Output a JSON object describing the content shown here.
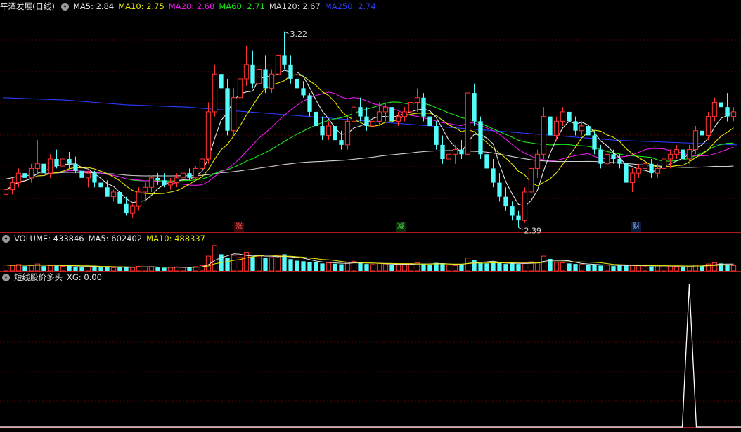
{
  "main_header": {
    "title": "平潭发展(日线)",
    "indicators": [
      {
        "text": "MA5: 2.84",
        "color": "#e6e6e6"
      },
      {
        "text": "MA10: 2.75",
        "color": "#e7e700"
      },
      {
        "text": "MA20: 2.68",
        "color": "#e619e6"
      },
      {
        "text": "MA60: 2.71",
        "color": "#19e619"
      },
      {
        "text": "MA120: 2.67",
        "color": "#d0d0d0"
      },
      {
        "text": "MA250: 2.74",
        "color": "#2a3cff"
      }
    ]
  },
  "price_high_label": "3.22",
  "price_low_label": "2.39",
  "markers": [
    {
      "label": "涨",
      "bg": "#3a0808",
      "color": "#ff5a5a"
    },
    {
      "label": "减",
      "bg": "#0a2a0a",
      "color": "#4fdc4f"
    },
    {
      "label": "财",
      "bg": "#0a1a3a",
      "color": "#9ab8ff"
    }
  ],
  "volume_header": {
    "name": "VOLUME: 433846",
    "ma5": "MA5: 602402",
    "ma10": "MA10: 488337"
  },
  "signal_header": {
    "name": "短线股价多头",
    "value": "XG: 0.00"
  },
  "colors": {
    "up": "#ff3232",
    "down": "#54fcfc",
    "grid": "#5a0000",
    "divider": "#b01818",
    "ma5": "#e6e6e6",
    "ma10": "#e7e700",
    "ma20": "#e619e6",
    "ma60": "#19e619",
    "ma120": "#d0d0d0",
    "ma250": "#2a3cff",
    "signal": "#ffffff"
  },
  "chart_data": {
    "type": "candlestick",
    "candles": [
      [
        2.53,
        2.57,
        2.51,
        2.55
      ],
      [
        2.55,
        2.6,
        2.53,
        2.58
      ],
      [
        2.58,
        2.64,
        2.56,
        2.62
      ],
      [
        2.62,
        2.66,
        2.6,
        2.6
      ],
      [
        2.6,
        2.66,
        2.58,
        2.64
      ],
      [
        2.64,
        2.76,
        2.62,
        2.66
      ],
      [
        2.66,
        2.68,
        2.6,
        2.62
      ],
      [
        2.62,
        2.7,
        2.6,
        2.68
      ],
      [
        2.68,
        2.72,
        2.64,
        2.65
      ],
      [
        2.65,
        2.7,
        2.63,
        2.68
      ],
      [
        2.68,
        2.71,
        2.64,
        2.66
      ],
      [
        2.66,
        2.69,
        2.62,
        2.63
      ],
      [
        2.63,
        2.65,
        2.58,
        2.6
      ],
      [
        2.6,
        2.63,
        2.56,
        2.62
      ],
      [
        2.62,
        2.63,
        2.56,
        2.58
      ],
      [
        2.58,
        2.6,
        2.54,
        2.56
      ],
      [
        2.56,
        2.59,
        2.52,
        2.52
      ],
      [
        2.52,
        2.55,
        2.5,
        2.54
      ],
      [
        2.54,
        2.56,
        2.48,
        2.49
      ],
      [
        2.49,
        2.52,
        2.44,
        2.45
      ],
      [
        2.45,
        2.49,
        2.43,
        2.48
      ],
      [
        2.48,
        2.56,
        2.46,
        2.54
      ],
      [
        2.54,
        2.58,
        2.5,
        2.56
      ],
      [
        2.56,
        2.61,
        2.54,
        2.6
      ],
      [
        2.6,
        2.62,
        2.57,
        2.59
      ],
      [
        2.59,
        2.62,
        2.56,
        2.57
      ],
      [
        2.57,
        2.6,
        2.55,
        2.58
      ],
      [
        2.58,
        2.62,
        2.56,
        2.6
      ],
      [
        2.6,
        2.64,
        2.58,
        2.62
      ],
      [
        2.62,
        2.64,
        2.59,
        2.6
      ],
      [
        2.6,
        2.65,
        2.59,
        2.64
      ],
      [
        2.64,
        2.72,
        2.62,
        2.68
      ],
      [
        2.68,
        2.92,
        2.66,
        2.88
      ],
      [
        2.88,
        3.08,
        2.86,
        3.04
      ],
      [
        3.04,
        3.12,
        2.96,
        2.98
      ],
      [
        2.98,
        3.02,
        2.78,
        2.8
      ],
      [
        2.8,
        2.98,
        2.78,
        2.94
      ],
      [
        2.94,
        3.04,
        2.92,
        3.02
      ],
      [
        3.02,
        3.16,
        2.99,
        3.08
      ],
      [
        3.08,
        3.14,
        2.98,
        3.0
      ],
      [
        3.0,
        3.1,
        2.98,
        3.06
      ],
      [
        3.06,
        3.12,
        2.96,
        2.98
      ],
      [
        2.98,
        3.06,
        2.96,
        3.04
      ],
      [
        3.04,
        3.14,
        3.02,
        3.12
      ],
      [
        3.12,
        3.22,
        3.06,
        3.08
      ],
      [
        3.08,
        3.12,
        3.0,
        3.02
      ],
      [
        3.02,
        3.04,
        2.96,
        2.98
      ],
      [
        2.98,
        3.01,
        2.94,
        2.95
      ],
      [
        2.95,
        2.96,
        2.86,
        2.88
      ],
      [
        2.88,
        2.92,
        2.8,
        2.82
      ],
      [
        2.82,
        2.86,
        2.76,
        2.78
      ],
      [
        2.78,
        2.84,
        2.76,
        2.82
      ],
      [
        2.82,
        2.86,
        2.74,
        2.76
      ],
      [
        2.76,
        2.8,
        2.72,
        2.74
      ],
      [
        2.74,
        2.86,
        2.72,
        2.84
      ],
      [
        2.84,
        2.96,
        2.82,
        2.9
      ],
      [
        2.9,
        2.94,
        2.84,
        2.86
      ],
      [
        2.86,
        2.9,
        2.8,
        2.82
      ],
      [
        2.82,
        2.86,
        2.8,
        2.84
      ],
      [
        2.84,
        2.92,
        2.82,
        2.88
      ],
      [
        2.88,
        2.92,
        2.84,
        2.9
      ],
      [
        2.9,
        2.92,
        2.82,
        2.84
      ],
      [
        2.84,
        2.88,
        2.82,
        2.86
      ],
      [
        2.86,
        2.9,
        2.84,
        2.88
      ],
      [
        2.88,
        2.94,
        2.86,
        2.92
      ],
      [
        2.92,
        2.98,
        2.88,
        2.94
      ],
      [
        2.94,
        2.96,
        2.84,
        2.86
      ],
      [
        2.86,
        2.88,
        2.8,
        2.82
      ],
      [
        2.82,
        2.84,
        2.72,
        2.74
      ],
      [
        2.74,
        2.78,
        2.66,
        2.68
      ],
      [
        2.68,
        2.72,
        2.66,
        2.7
      ],
      [
        2.7,
        2.74,
        2.66,
        2.72
      ],
      [
        2.72,
        2.76,
        2.68,
        2.7
      ],
      [
        2.7,
        2.98,
        2.68,
        2.96
      ],
      [
        2.96,
        3.0,
        2.82,
        2.84
      ],
      [
        2.84,
        2.86,
        2.68,
        2.7
      ],
      [
        2.7,
        2.74,
        2.62,
        2.64
      ],
      [
        2.64,
        2.68,
        2.56,
        2.58
      ],
      [
        2.58,
        2.62,
        2.5,
        2.52
      ],
      [
        2.52,
        2.56,
        2.46,
        2.48
      ],
      [
        2.48,
        2.5,
        2.42,
        2.44
      ],
      [
        2.44,
        2.46,
        2.39,
        2.42
      ],
      [
        2.42,
        2.56,
        2.41,
        2.54
      ],
      [
        2.54,
        2.66,
        2.52,
        2.64
      ],
      [
        2.64,
        2.72,
        2.6,
        2.7
      ],
      [
        2.7,
        2.9,
        2.68,
        2.86
      ],
      [
        2.86,
        2.92,
        2.74,
        2.78
      ],
      [
        2.78,
        2.86,
        2.76,
        2.84
      ],
      [
        2.84,
        2.9,
        2.82,
        2.88
      ],
      [
        2.88,
        2.9,
        2.82,
        2.84
      ],
      [
        2.84,
        2.86,
        2.78,
        2.8
      ],
      [
        2.8,
        2.84,
        2.78,
        2.82
      ],
      [
        2.82,
        2.84,
        2.76,
        2.78
      ],
      [
        2.78,
        2.8,
        2.7,
        2.72
      ],
      [
        2.72,
        2.74,
        2.64,
        2.66
      ],
      [
        2.66,
        2.72,
        2.62,
        2.7
      ],
      [
        2.7,
        2.72,
        2.66,
        2.68
      ],
      [
        2.68,
        2.7,
        2.64,
        2.66
      ],
      [
        2.66,
        2.68,
        2.56,
        2.58
      ],
      [
        2.58,
        2.64,
        2.54,
        2.62
      ],
      [
        2.62,
        2.66,
        2.6,
        2.64
      ],
      [
        2.64,
        2.68,
        2.6,
        2.66
      ],
      [
        2.66,
        2.68,
        2.6,
        2.62
      ],
      [
        2.62,
        2.66,
        2.6,
        2.64
      ],
      [
        2.64,
        2.7,
        2.62,
        2.68
      ],
      [
        2.68,
        2.72,
        2.64,
        2.7
      ],
      [
        2.7,
        2.74,
        2.68,
        2.72
      ],
      [
        2.72,
        2.74,
        2.66,
        2.68
      ],
      [
        2.68,
        2.74,
        2.66,
        2.72
      ],
      [
        2.72,
        2.82,
        2.7,
        2.8
      ],
      [
        2.8,
        2.86,
        2.76,
        2.78
      ],
      [
        2.78,
        2.88,
        2.76,
        2.86
      ],
      [
        2.86,
        2.94,
        2.84,
        2.92
      ],
      [
        2.92,
        2.98,
        2.86,
        2.9
      ],
      [
        2.9,
        2.96,
        2.84,
        2.86
      ],
      [
        2.86,
        2.9,
        2.84,
        2.88
      ]
    ],
    "ma250": [
      2.94,
      2.93,
      2.91,
      2.9,
      2.88,
      2.86,
      2.84,
      2.82,
      2.8,
      2.78,
      2.76,
      2.75,
      2.74
    ],
    "ylim": [
      2.37,
      3.3
    ],
    "volume": [
      0.22,
      0.2,
      0.24,
      0.18,
      0.2,
      0.26,
      0.18,
      0.2,
      0.19,
      0.17,
      0.21,
      0.16,
      0.15,
      0.18,
      0.14,
      0.13,
      0.15,
      0.12,
      0.14,
      0.16,
      0.13,
      0.17,
      0.15,
      0.16,
      0.13,
      0.12,
      0.14,
      0.15,
      0.13,
      0.12,
      0.16,
      0.2,
      0.55,
      0.95,
      0.62,
      0.48,
      0.58,
      0.5,
      0.7,
      0.52,
      0.55,
      0.48,
      0.5,
      0.58,
      0.62,
      0.44,
      0.38,
      0.36,
      0.32,
      0.34,
      0.28,
      0.3,
      0.27,
      0.25,
      0.32,
      0.36,
      0.3,
      0.26,
      0.24,
      0.28,
      0.26,
      0.24,
      0.22,
      0.25,
      0.27,
      0.3,
      0.26,
      0.24,
      0.3,
      0.28,
      0.22,
      0.2,
      0.22,
      0.48,
      0.42,
      0.3,
      0.28,
      0.32,
      0.3,
      0.26,
      0.28,
      0.26,
      0.3,
      0.34,
      0.32,
      0.55,
      0.45,
      0.32,
      0.3,
      0.28,
      0.26,
      0.24,
      0.22,
      0.24,
      0.2,
      0.22,
      0.18,
      0.2,
      0.22,
      0.2,
      0.19,
      0.18,
      0.17,
      0.19,
      0.2,
      0.18,
      0.17,
      0.16,
      0.18,
      0.22,
      0.2,
      0.26,
      0.3,
      0.28,
      0.24,
      0.2
    ],
    "signal_spike_index": 108
  }
}
